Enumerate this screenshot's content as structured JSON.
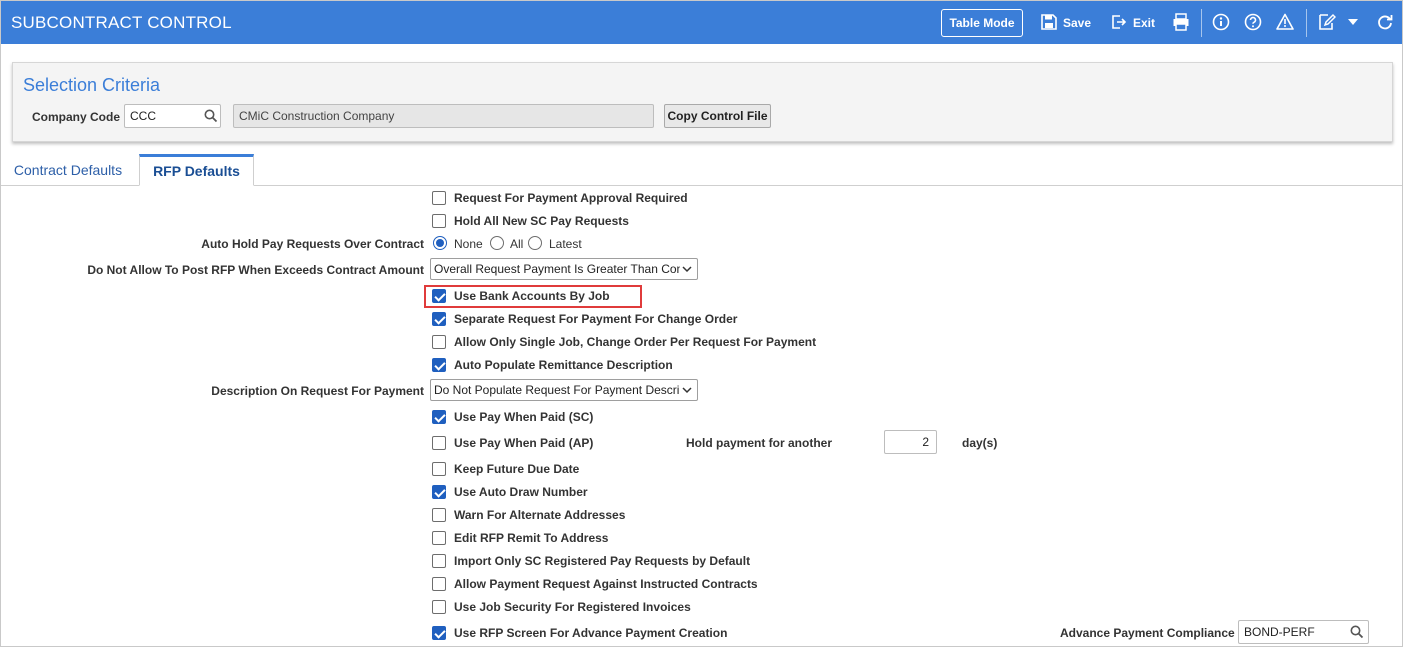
{
  "header": {
    "title": "SUBCONTRACT CONTROL",
    "table_mode_label": "Table Mode",
    "save_label": "Save",
    "exit_label": "Exit"
  },
  "criteria": {
    "title": "Selection Criteria",
    "company_code_label": "Company Code",
    "company_code_value": "CCC",
    "company_name_value": "CMiC Construction Company",
    "copy_button_label": "Copy Control File"
  },
  "tabs": [
    {
      "label": "Contract Defaults",
      "active": false
    },
    {
      "label": "RFP Defaults",
      "active": true
    }
  ],
  "form": {
    "rfp_approval_required": {
      "label": "Request For Payment Approval Required",
      "checked": false
    },
    "hold_all_new": {
      "label": "Hold All New SC Pay Requests",
      "checked": false
    },
    "auto_hold": {
      "label": "Auto Hold Pay Requests Over Contract",
      "options": [
        "None",
        "All",
        "Latest"
      ],
      "selected": "None"
    },
    "do_not_allow": {
      "label": "Do Not Allow To Post RFP When Exceeds Contract Amount",
      "value": "Overall Request Payment Is Greater Than Contract"
    },
    "use_bank_accounts": {
      "label": "Use Bank Accounts By Job",
      "checked": true
    },
    "separate_request": {
      "label": "Separate Request For Payment For Change Order",
      "checked": true
    },
    "allow_only_single": {
      "label": "Allow Only Single Job, Change Order Per Request For Payment",
      "checked": false
    },
    "auto_populate": {
      "label": "Auto Populate Remittance Description",
      "checked": true
    },
    "description_on_rfp": {
      "label": "Description On Request For Payment",
      "value": "Do Not Populate Request For Payment Description"
    },
    "pay_when_paid_sc": {
      "label": "Use Pay When Paid (SC)",
      "checked": true
    },
    "pay_when_paid_ap": {
      "label": "Use Pay When Paid (AP)",
      "checked": false
    },
    "hold_payment_label": "Hold payment for another",
    "hold_payment_value": "2",
    "hold_payment_unit": "day(s)",
    "keep_future_due": {
      "label": "Keep Future Due Date",
      "checked": false
    },
    "auto_draw_number": {
      "label": "Use Auto Draw Number",
      "checked": true
    },
    "warn_alternate": {
      "label": "Warn For Alternate Addresses",
      "checked": false
    },
    "edit_remit": {
      "label": "Edit RFP Remit To Address",
      "checked": false
    },
    "import_only_sc": {
      "label": "Import Only SC Registered Pay Requests by Default",
      "checked": false
    },
    "allow_payment_instructed": {
      "label": "Allow Payment Request Against Instructed Contracts",
      "checked": false
    },
    "job_security": {
      "label": "Use Job Security For Registered Invoices",
      "checked": false
    },
    "rfp_advance": {
      "label": "Use RFP Screen For Advance Payment Creation",
      "checked": true
    },
    "advance_compliance_label": "Advance Payment Compliance",
    "advance_compliance_value": "BOND-PERF"
  },
  "colors": {
    "header_bg": "#3b7ed8",
    "accent": "#1f5fbf",
    "highlight": "#e03b3b"
  }
}
